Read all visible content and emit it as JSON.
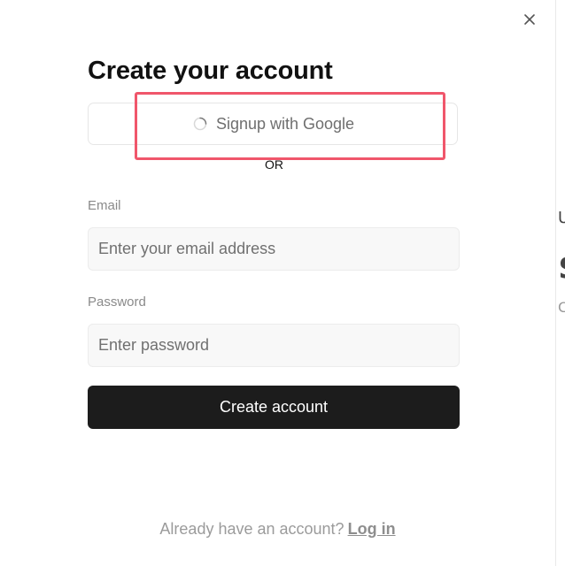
{
  "modal": {
    "title": "Create your account",
    "close_icon": "close-icon",
    "google_button": {
      "label": "Signup with Google",
      "icon": "loading-spinner-icon"
    },
    "separator": "OR",
    "email": {
      "label": "Email",
      "placeholder": "Enter your email address",
      "value": ""
    },
    "password": {
      "label": "Password",
      "placeholder": "Enter password",
      "value": ""
    },
    "submit_label": "Create account",
    "footer": {
      "prompt": "Already have an account?",
      "link": "Log in"
    }
  },
  "background_peek": [
    "U",
    "$",
    "C"
  ],
  "colors": {
    "highlight": "#f0566b",
    "button_dark": "#1c1c1c",
    "input_bg": "#f8f8f8"
  }
}
